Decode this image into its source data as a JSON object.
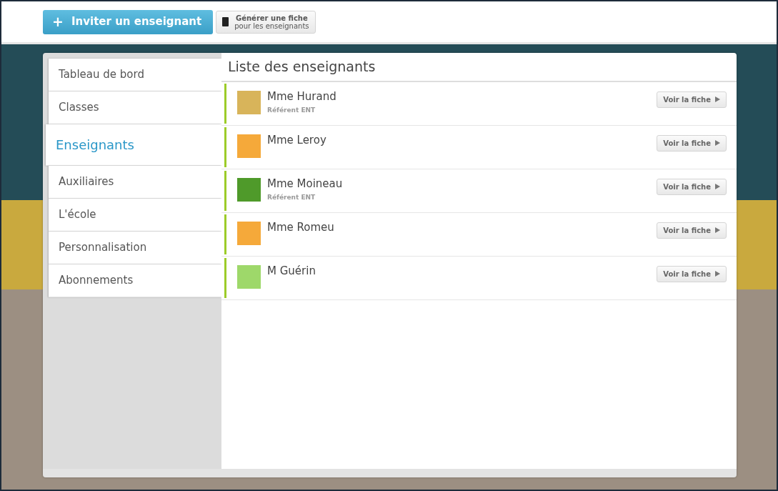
{
  "toolbar": {
    "invite_button": {
      "icon": "+",
      "label": "Inviter un enseignant"
    },
    "sheet_button": {
      "title": "Générer une fiche",
      "subtitle": "pour les enseignants"
    }
  },
  "sidebar": {
    "items": [
      {
        "label": "Tableau de bord",
        "selected": false
      },
      {
        "label": "Classes",
        "selected": false
      },
      {
        "label": "Enseignants",
        "selected": true
      },
      {
        "label": "Auxiliaires",
        "selected": false
      },
      {
        "label": "L'école",
        "selected": false
      },
      {
        "label": "Personnalisation",
        "selected": false
      },
      {
        "label": "Abonnements",
        "selected": false
      }
    ]
  },
  "list": {
    "title": "Liste des enseignants",
    "teachers": [
      {
        "name": "Mme Hurand",
        "role": "Référent ENT",
        "avatar": {
          "color": "#d8b45a"
        },
        "action": "Voir la fiche"
      },
      {
        "name": "Mme Leroy",
        "avatar": {
          "color": "#f5a93a"
        },
        "action": "Voir la fiche"
      },
      {
        "name": "Mme Moineau",
        "role": "Référent ENT",
        "avatar": {
          "color": "#4f9a2a"
        },
        "action": "Voir la fiche"
      },
      {
        "name": "Mme Romeu",
        "avatar": {
          "color": "#f5a93a"
        },
        "action": "Voir la fiche"
      },
      {
        "name": "M Guérin",
        "avatar": {
          "color": "#9ed86a"
        },
        "action": "Voir la fiche"
      }
    ]
  }
}
